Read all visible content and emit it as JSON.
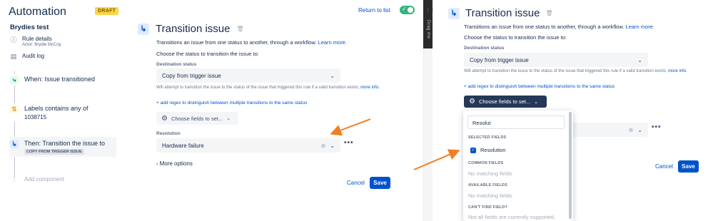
{
  "left": {
    "app_title": "Automation",
    "draft_badge": "DRAFT",
    "rule_name": "Brydies test",
    "rule_details": "Rule details",
    "actor": "Actor: Brydie McCoy",
    "audit_log": "Audit log",
    "components": [
      {
        "label": "When: Issue transitioned"
      },
      {
        "label": "Labels contains any of",
        "sub": "1038715"
      },
      {
        "label": "Then: Transition the issue to",
        "tag": "COPY FROM TRIGGER ISSUE"
      }
    ],
    "add_component": "Add component",
    "return_link": "Return to list",
    "panel": {
      "title": "Transition issue",
      "desc": "Transitions an issue from one status to another, through a workflow.",
      "learn_more": "Learn more.",
      "choose_status": "Choose the status to transition the issue to:",
      "destination_label": "Destination status",
      "destination_value": "Copy from trigger issue",
      "help_text": "Will attempt to transition the issue to the status of the issue that triggered this rule if a valid transition exists;",
      "more_info": "more info.",
      "regex_link": "+ add regex to distinguish between multiple transitions to the same status",
      "choose_fields": "Choose fields to set...",
      "resolution_label": "Resolution",
      "resolution_value": "Hardware failure",
      "more_options": "More options",
      "cancel": "Cancel",
      "save": "Save"
    }
  },
  "divider": {
    "drag_label": "Drag me"
  },
  "right": {
    "panel": {
      "title": "Transition issue",
      "desc": "Transitions an issue from one status to another, through a workflow.",
      "learn_more": "Learn more.",
      "choose_status": "Choose the status to transition the issue to:",
      "destination_label": "Destination status",
      "destination_value": "Copy from trigger issue",
      "help_text": "Will attempt to transition the issue to the status of the issue that triggered this rule if a valid transition exists;",
      "more_info": "more info.",
      "regex_link": "+ add regex to distinguish between multiple transitions to the same status",
      "choose_fields": "Choose fields to set...",
      "cancel": "Cancel",
      "save": "Save"
    },
    "dropdown": {
      "search_value": "Resolut",
      "selected_header": "SELECTED FIELDS",
      "selected_item": "Resolution",
      "common_header": "COMMON FIELDS",
      "common_empty": "No matching fields",
      "available_header": "AVAILABLE FIELDS",
      "available_empty": "No matching fields",
      "cant_find_header": "CAN'T FIND FIELD?",
      "cant_find_text": "Not all fields are currently supported,"
    }
  },
  "colors": {
    "accent": "#0052cc",
    "arrow": "#f07f23",
    "draft": "#ffd44a",
    "toggle": "#36b37e"
  }
}
